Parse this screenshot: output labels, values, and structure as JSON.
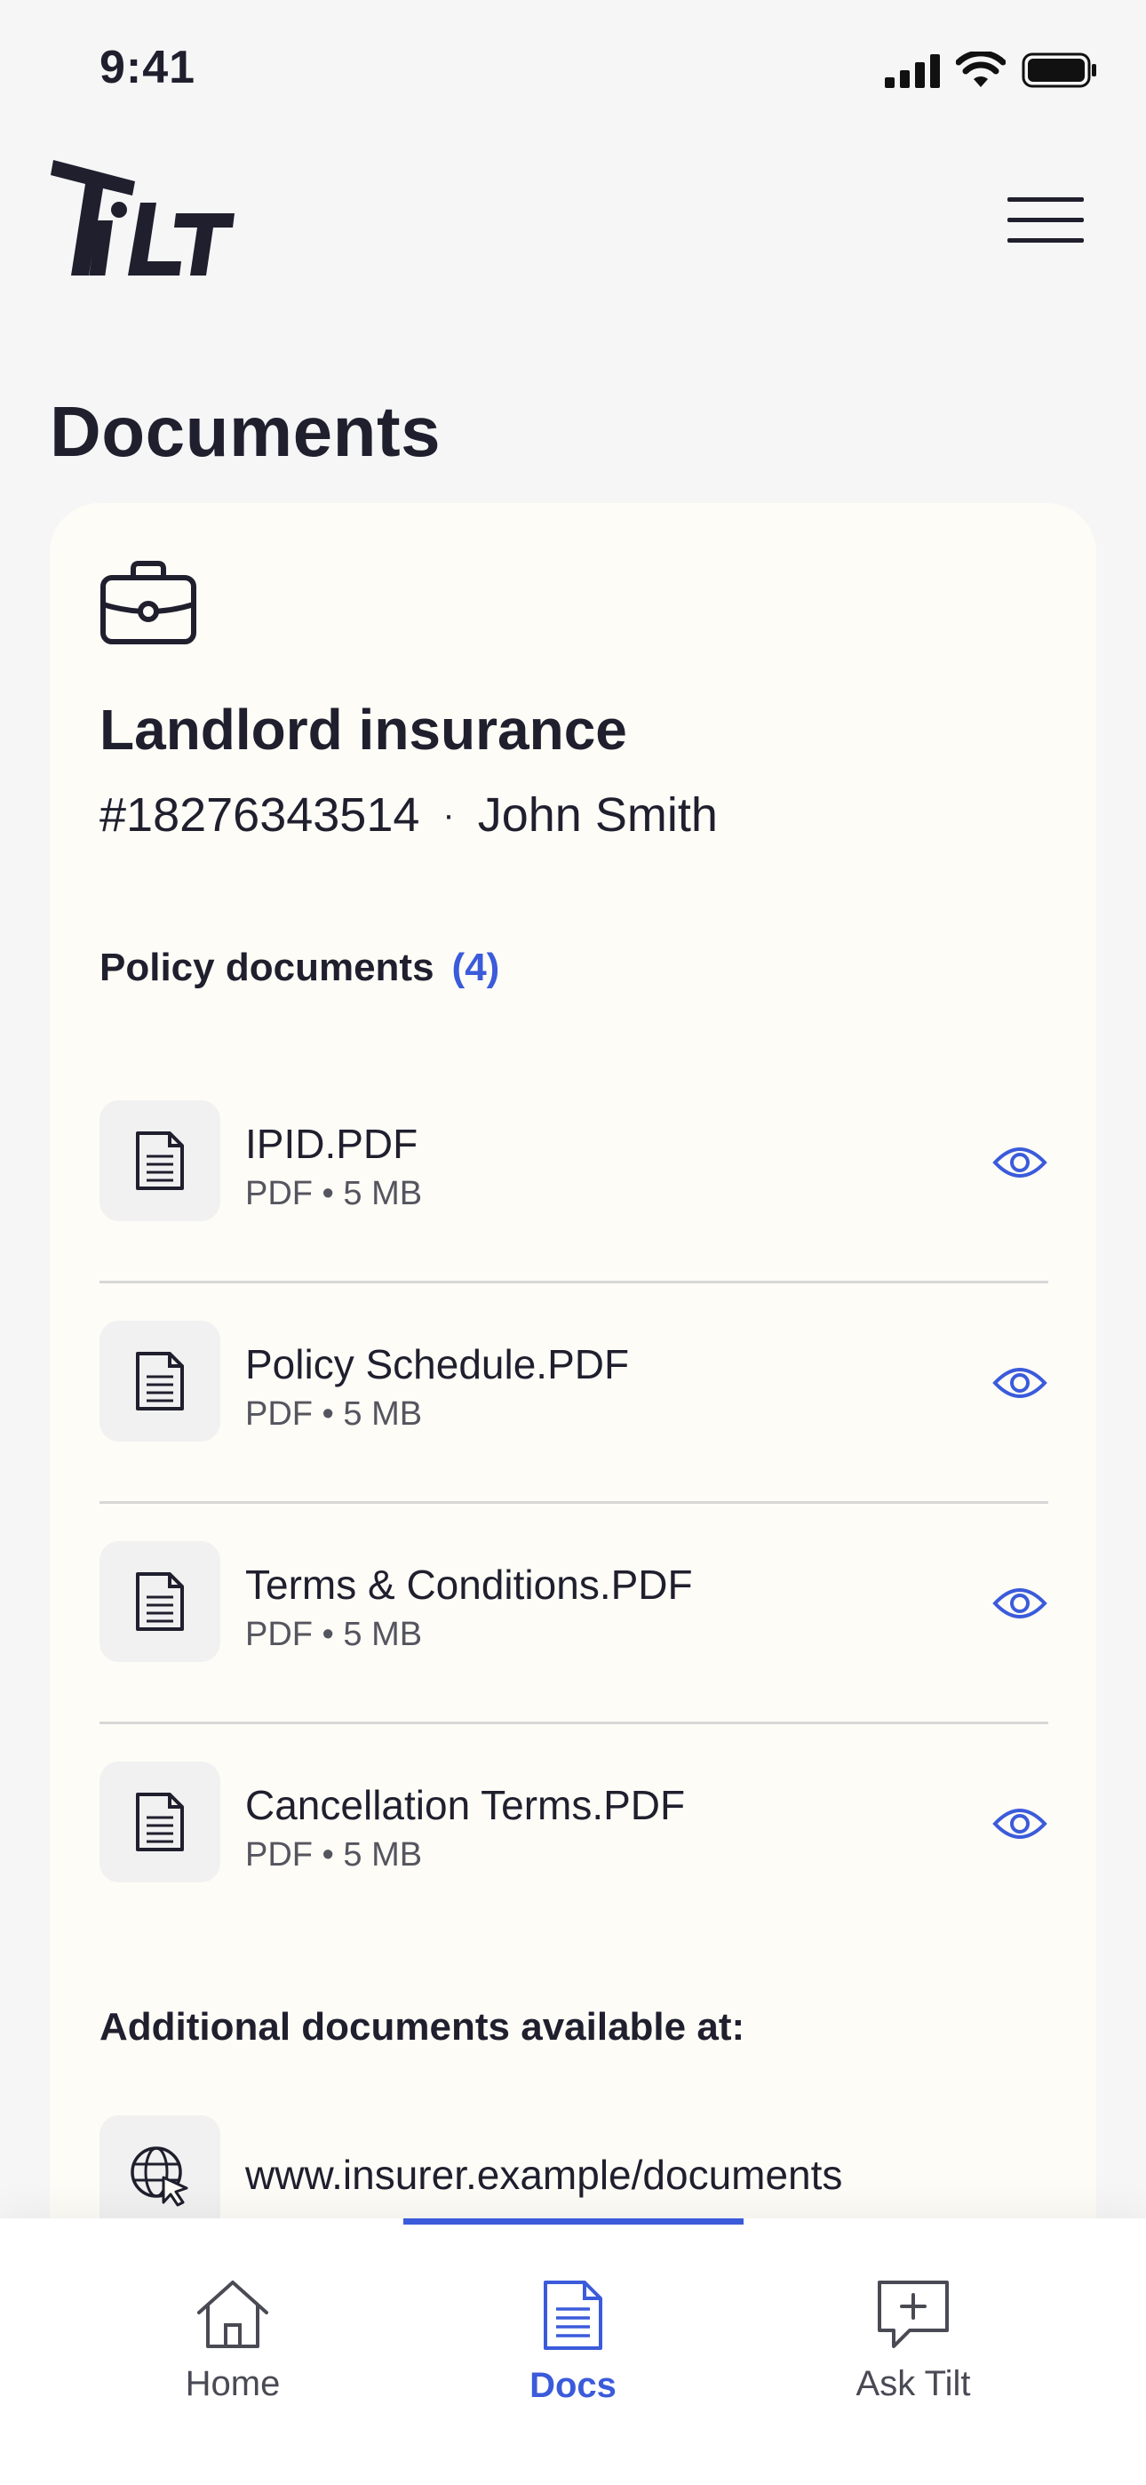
{
  "status_bar": {
    "time": "9:41"
  },
  "brand": {
    "logo_text": "TiLT"
  },
  "page": {
    "title": "Documents"
  },
  "policy": {
    "title": "Landlord insurance",
    "number": "#18276343514",
    "separator": "·",
    "holder": "John Smith"
  },
  "policy_documents": {
    "heading": "Policy documents",
    "count": "(4)",
    "items": [
      {
        "name": "IPID.PDF",
        "info": "PDF • 5 MB"
      },
      {
        "name": "Policy Schedule.PDF",
        "info": "PDF • 5 MB"
      },
      {
        "name": "Terms & Conditions.PDF",
        "info": "PDF • 5 MB"
      },
      {
        "name": "Cancellation Terms.PDF",
        "info": "PDF • 5 MB"
      }
    ]
  },
  "additional": {
    "heading": "Additional documents available at:",
    "link": "www.insurer.example/documents"
  },
  "tabs": [
    {
      "label": "Home",
      "icon": "home-icon",
      "active": false
    },
    {
      "label": "Docs",
      "icon": "document-icon",
      "active": true
    },
    {
      "label": "Ask Tilt",
      "icon": "chat-plus-icon",
      "active": false
    }
  ],
  "colors": {
    "accent": "#3b5bdb",
    "text": "#1f1f2e",
    "card": "#fdfcf7",
    "background": "#f6f6f7"
  }
}
